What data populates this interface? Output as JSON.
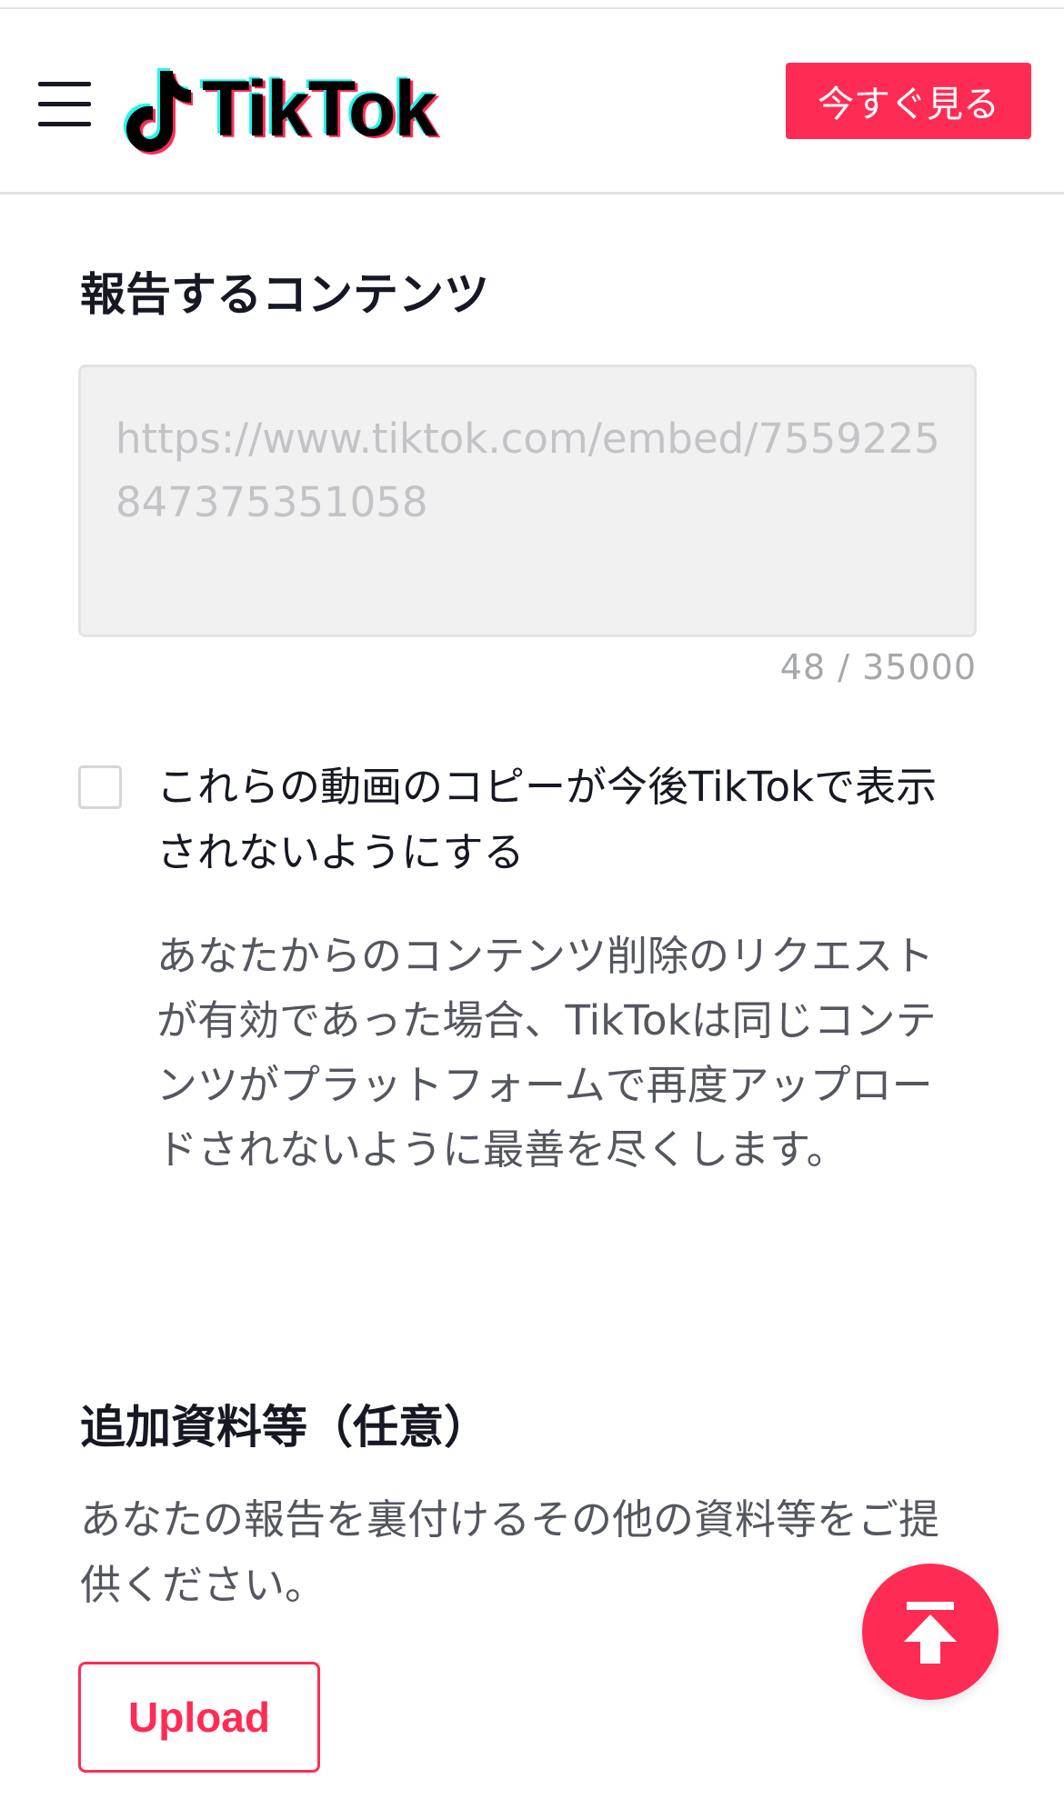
{
  "header": {
    "logo_text": "TikTok",
    "watch_now_label": "今すぐ見る"
  },
  "report_section": {
    "title": "報告するコンテンツ",
    "textarea_value": "https://www.tiktok.com/embed/7559225847375351058",
    "char_count": "48 / 35000"
  },
  "prevent_copies": {
    "label": "これらの動画のコピーが今後TikTokで表示されないようにする",
    "checked": false,
    "description": "あなたからのコンテンツ削除のリクエストが有効であった場合、TikTokは同じコンテンツがプラットフォームで再度アップロードされないように最善を尽くします。"
  },
  "extra_section": {
    "title": "追加資料等（任意）",
    "description": "あなたの報告を裏付けるその他の資料等をご提供ください。",
    "upload_label": "Upload"
  },
  "icons": {
    "menu": "hamburger-menu-icon",
    "logo": "tiktok-note-icon",
    "back_to_top": "arrow-up-to-top-icon"
  },
  "colors": {
    "brand_red": "#fe2c55",
    "brand_cyan": "#25f4ee",
    "text_primary": "#161823",
    "text_secondary": "#545660"
  }
}
